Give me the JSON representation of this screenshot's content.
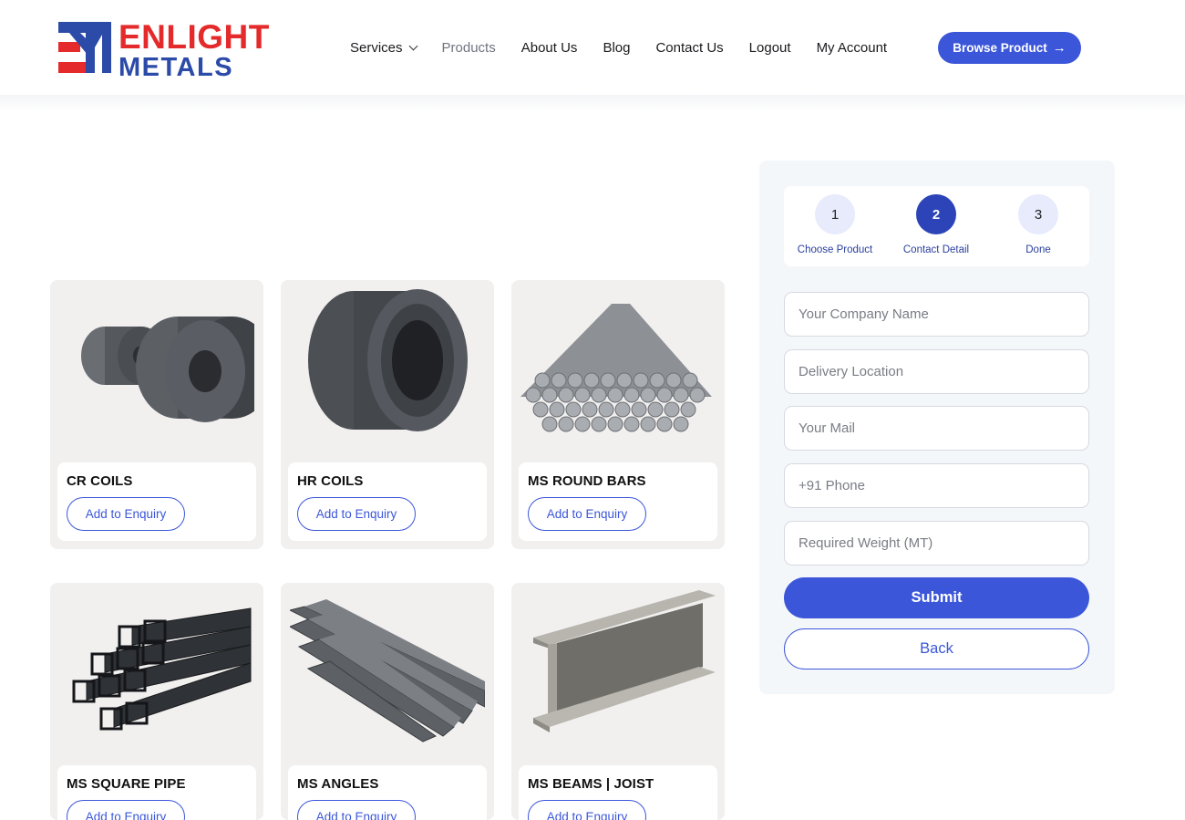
{
  "brand": {
    "line1": "ENLIGHT",
    "line2": "METALS",
    "red": "#e42a2a",
    "blue": "#2c4aa8"
  },
  "nav": {
    "items": [
      {
        "label": "Services",
        "has_dropdown": true,
        "icon": "chevron-down-icon"
      },
      {
        "label": "Products",
        "state": "current"
      },
      {
        "label": "About Us"
      },
      {
        "label": "Blog"
      },
      {
        "label": "Contact Us"
      },
      {
        "label": "Logout"
      },
      {
        "label": "My Account"
      }
    ],
    "cta": {
      "label": "Browse Product",
      "icon": "arrow-right-icon"
    }
  },
  "products": [
    {
      "name": "CR COILS",
      "button": "Add to Enquiry",
      "image": "cr-coil-image"
    },
    {
      "name": "HR COILS",
      "button": "Add to Enquiry",
      "image": "hr-coil-image"
    },
    {
      "name": "MS ROUND BARS",
      "button": "Add to Enquiry",
      "image": "round-bars-image"
    },
    {
      "name": "MS SQUARE PIPE",
      "button": "Add to Enquiry",
      "image": "square-pipe-image"
    },
    {
      "name": "MS ANGLES",
      "button": "Add to Enquiry",
      "image": "angles-image"
    },
    {
      "name": "MS BEAMS | JOIST",
      "button": "Add to Enquiry",
      "image": "beam-image"
    }
  ],
  "steps": [
    {
      "number": "1",
      "label": "Choose Product"
    },
    {
      "number": "2",
      "label": "Contact Detail",
      "active": true
    },
    {
      "number": "3",
      "label": "Done"
    }
  ],
  "form": {
    "company": {
      "placeholder": "Your Company Name",
      "value": ""
    },
    "location": {
      "placeholder": "Delivery Location",
      "value": ""
    },
    "mail": {
      "placeholder": "Your Mail",
      "value": ""
    },
    "phone": {
      "placeholder": "+91 Phone",
      "value": ""
    },
    "weight": {
      "placeholder": "Required Weight (MT)",
      "value": ""
    },
    "submit_label": "Submit",
    "back_label": "Back"
  },
  "colors": {
    "accent": "#3b56d9",
    "step_active": "#2c44b8",
    "card_bg": "#f1f0ef",
    "panel_bg": "#f4f7fa"
  }
}
